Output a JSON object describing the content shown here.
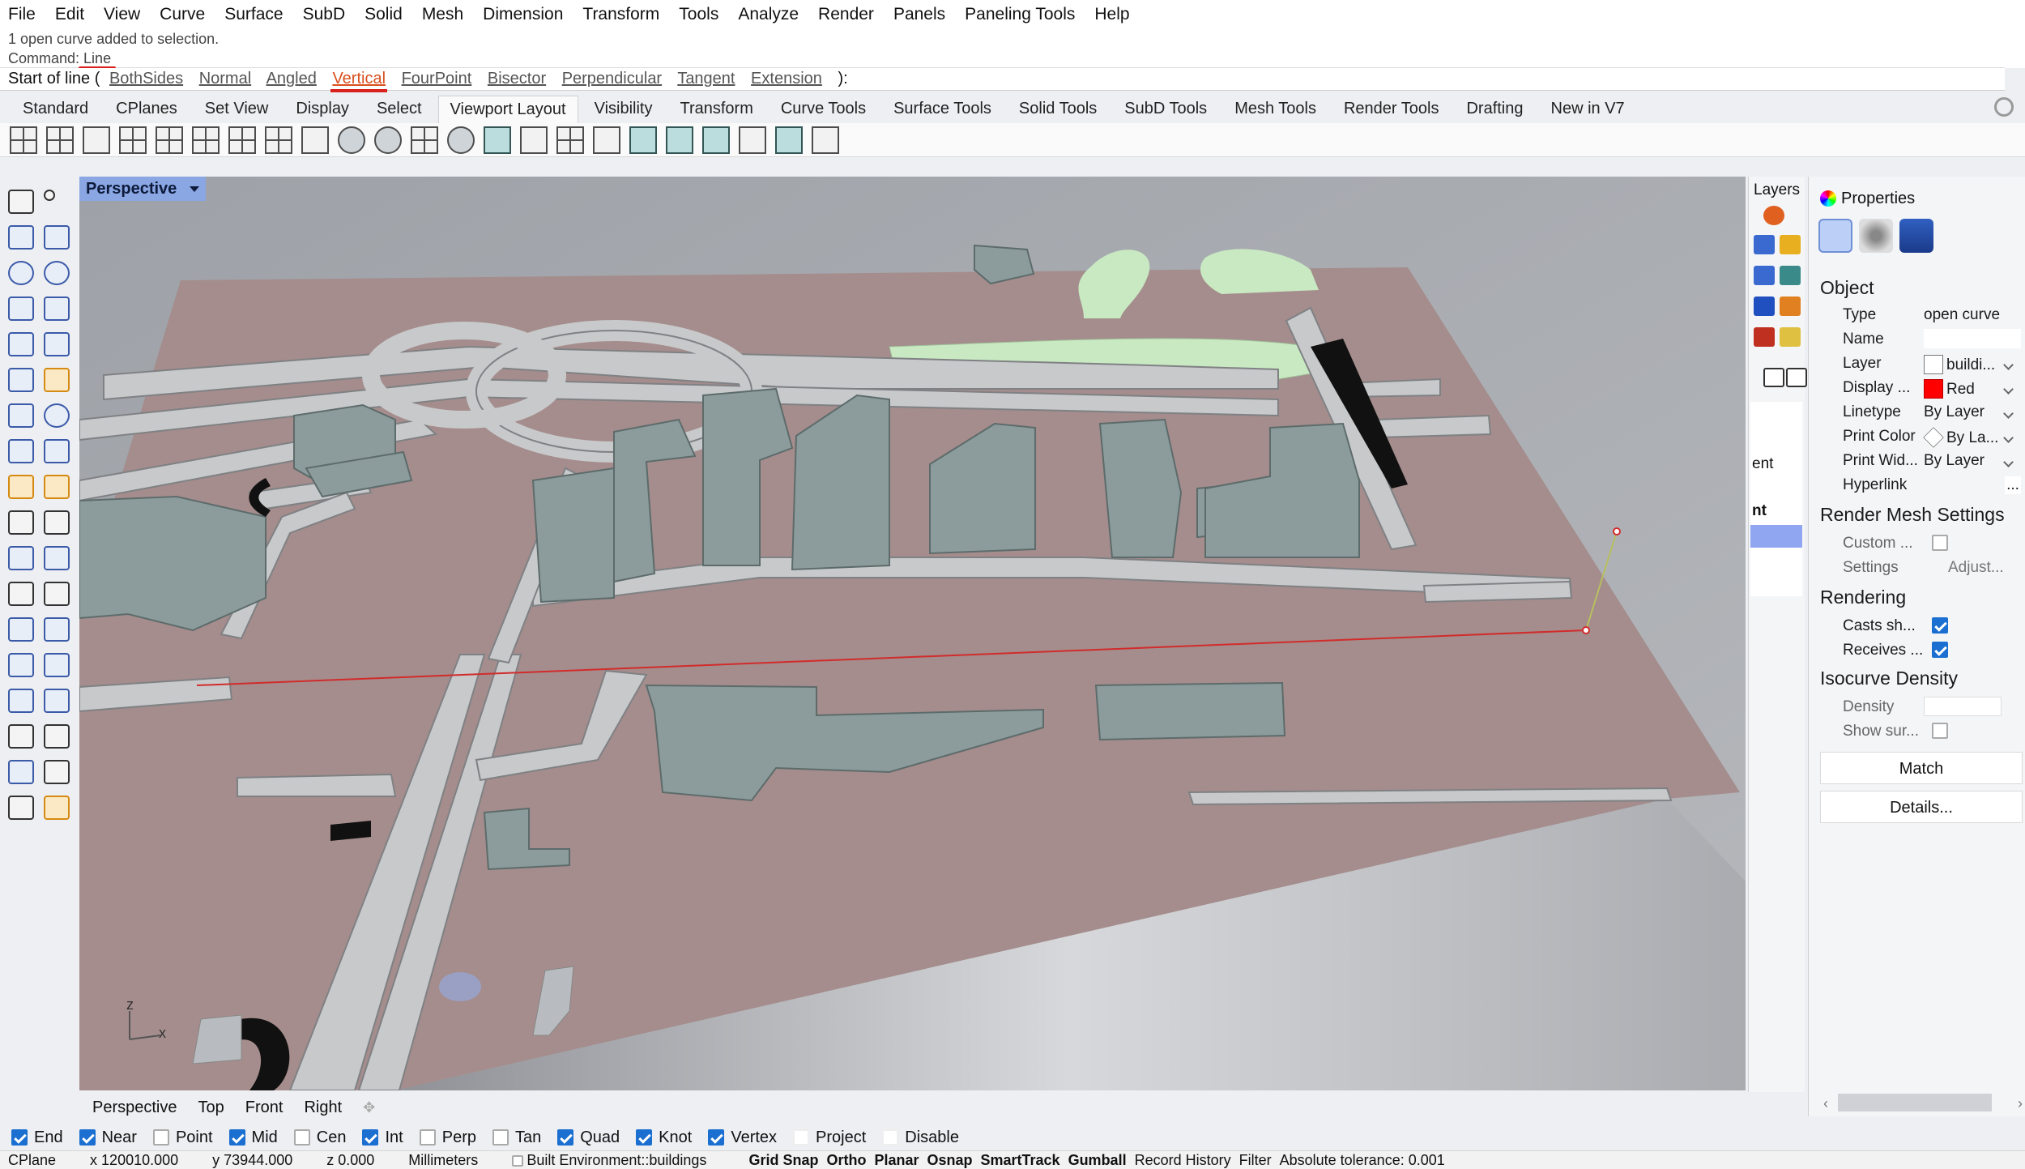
{
  "menu": [
    "File",
    "Edit",
    "View",
    "Curve",
    "Surface",
    "SubD",
    "Solid",
    "Mesh",
    "Dimension",
    "Transform",
    "Tools",
    "Analyze",
    "Render",
    "Panels",
    "Paneling Tools",
    "Help"
  ],
  "history": {
    "line1": "1 open curve added to selection.",
    "line2_prefix": "Command: ",
    "line2_cmd": "Line"
  },
  "command": {
    "lead": "Start of line (",
    "options": [
      "BothSides",
      "Normal",
      "Angled",
      "Vertical",
      "FourPoint",
      "Bisector",
      "Perpendicular",
      "Tangent",
      "Extension"
    ],
    "active_option": "Vertical",
    "trail": "):"
  },
  "tabs": [
    "Standard",
    "CPlanes",
    "Set View",
    "Display",
    "Select",
    "Viewport Layout",
    "Visibility",
    "Transform",
    "Curve Tools",
    "Surface Tools",
    "Solid Tools",
    "SubD Tools",
    "Mesh Tools",
    "Render Tools",
    "Drafting",
    "New in V7"
  ],
  "active_tab": "Viewport Layout",
  "viewport": {
    "title": "Perspective",
    "tabs": [
      "Perspective",
      "Top",
      "Front",
      "Right"
    ],
    "axis_x": "x",
    "axis_z": "z"
  },
  "layers": {
    "title": "Layers",
    "frag1": "ent",
    "frag2": "nt"
  },
  "properties": {
    "title": "Properties",
    "object_header": "Object",
    "rows": [
      {
        "key": "Type",
        "value": "open curve"
      },
      {
        "key": "Name",
        "value": ""
      },
      {
        "key": "Layer",
        "value": "buildi..."
      },
      {
        "key": "Display ...",
        "value": "Red"
      },
      {
        "key": "Linetype",
        "value": "By Layer"
      },
      {
        "key": "Print Color",
        "value": "By La..."
      },
      {
        "key": "Print Wid...",
        "value": "By Layer"
      },
      {
        "key": "Hyperlink",
        "value": "..."
      }
    ],
    "render_mesh_header": "Render Mesh Settings",
    "custom_label": "Custom ...",
    "settings_label": "Settings",
    "adjust_label": "Adjust...",
    "rendering_header": "Rendering",
    "casts_label": "Casts sh...",
    "receives_label": "Receives ...",
    "isocurve_header": "Isocurve Density",
    "density_label": "Density",
    "show_label": "Show sur...",
    "match_button": "Match",
    "details_button": "Details..."
  },
  "colors": {
    "display_red": "#ff0000",
    "ground": "#a48d8c",
    "building": "#8c9c9c",
    "grass": "#c9e9c2",
    "accent": "#8aa7e3"
  },
  "osnap": [
    {
      "label": "End",
      "checked": true
    },
    {
      "label": "Near",
      "checked": true
    },
    {
      "label": "Point",
      "checked": false
    },
    {
      "label": "Mid",
      "checked": true
    },
    {
      "label": "Cen",
      "checked": false
    },
    {
      "label": "Int",
      "checked": true
    },
    {
      "label": "Perp",
      "checked": false
    },
    {
      "label": "Tan",
      "checked": false
    },
    {
      "label": "Quad",
      "checked": true
    },
    {
      "label": "Knot",
      "checked": true
    },
    {
      "label": "Vertex",
      "checked": true
    },
    {
      "label": "Project",
      "checked": false
    },
    {
      "label": "Disable",
      "checked": false
    }
  ],
  "status": {
    "cplane": "CPlane",
    "x": "x 120010.000",
    "y": "y 73944.000",
    "z": "z 0.000",
    "units": "Millimeters",
    "layer": "Built Environment::buildings",
    "modes": [
      "Grid Snap",
      "Ortho",
      "Planar",
      "Osnap",
      "SmartTrack",
      "Gumball"
    ],
    "record": "Record History",
    "filter": "Filter",
    "tolerance": "Absolute tolerance: 0.001"
  }
}
